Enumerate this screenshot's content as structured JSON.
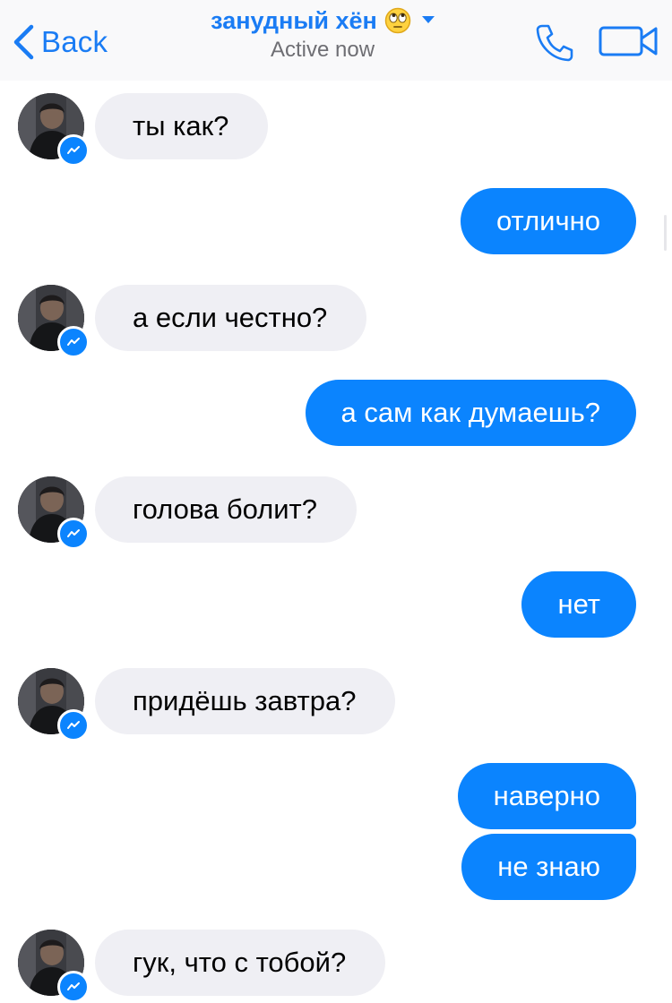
{
  "header": {
    "back_label": "Back",
    "contact_name": "занудный хён",
    "status": "Active now"
  },
  "icons": {
    "back": "chevron-left-icon",
    "emoji": "eye-roll-emoji-icon",
    "dropdown": "caret-down-icon",
    "call": "phone-icon",
    "video": "video-camera-icon",
    "badge": "messenger-badge-icon"
  },
  "colors": {
    "accent": "#1a7cf4",
    "outgoing_bubble": "#0b84fe",
    "incoming_bubble": "#efeff4"
  },
  "messages": [
    {
      "from": "them",
      "text": "ты как?"
    },
    {
      "from": "me",
      "text": "отлично"
    },
    {
      "from": "them",
      "text": "а если честно?"
    },
    {
      "from": "me",
      "text": "а сам как думаешь?"
    },
    {
      "from": "them",
      "text": "голова болит?"
    },
    {
      "from": "me",
      "text": "нет"
    },
    {
      "from": "them",
      "text": "придёшь завтра?"
    },
    {
      "from": "me",
      "text": "наверно"
    },
    {
      "from": "me",
      "text": "не знаю"
    },
    {
      "from": "them",
      "text": "гук, что с тобой?"
    }
  ]
}
